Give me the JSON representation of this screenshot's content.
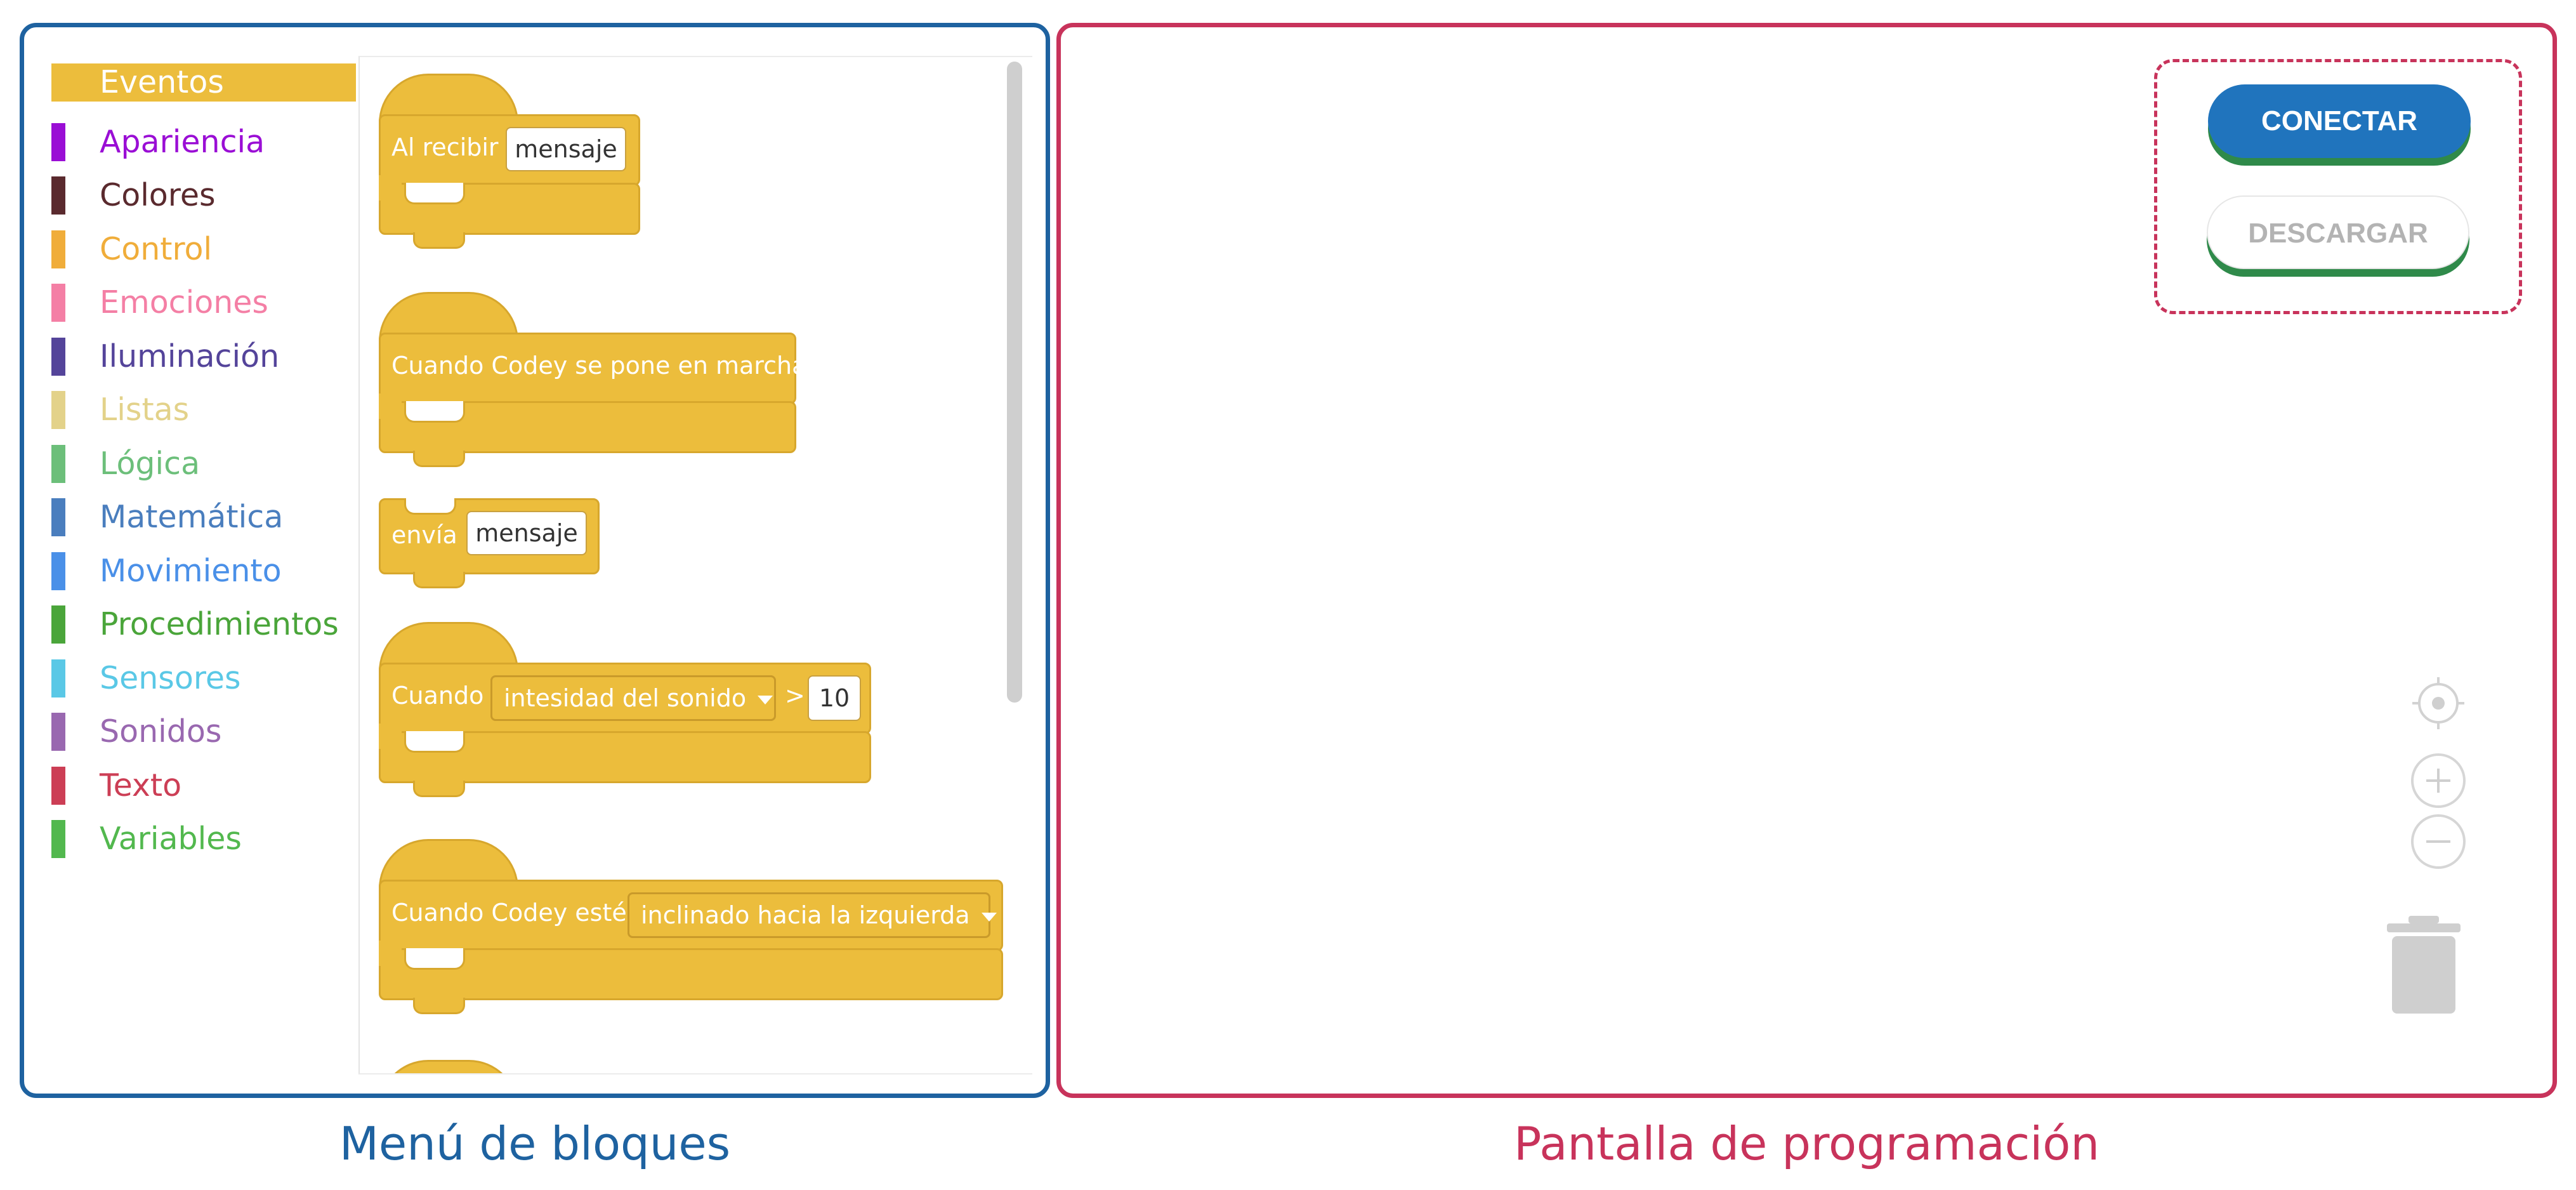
{
  "captions": {
    "menu": "Menú de bloques",
    "workspace": "Pantalla de programación"
  },
  "categories": [
    {
      "label": "Eventos",
      "color": "#ecbd3c",
      "selected": true
    },
    {
      "label": "Apariencia",
      "color": "#9a0ed5"
    },
    {
      "label": "Colores",
      "color": "#5a2a2e"
    },
    {
      "label": "Control",
      "color": "#f0ad3a"
    },
    {
      "label": "Emociones",
      "color": "#f47fa5"
    },
    {
      "label": "Iluminación",
      "color": "#54449a"
    },
    {
      "label": "Listas",
      "color": "#e3d28a"
    },
    {
      "label": "Lógica",
      "color": "#6cbf7a"
    },
    {
      "label": "Matemática",
      "color": "#4a7ebe"
    },
    {
      "label": "Movimiento",
      "color": "#4a90e8"
    },
    {
      "label": "Procedimientos",
      "color": "#4aa53a"
    },
    {
      "label": "Sensores",
      "color": "#5ac8e6"
    },
    {
      "label": "Sonidos",
      "color": "#9968b0"
    },
    {
      "label": "Texto",
      "color": "#cc3e55"
    },
    {
      "label": "Variables",
      "color": "#52b84e"
    }
  ],
  "blocks": {
    "receive": {
      "text": "Al recibir",
      "field": "mensaje"
    },
    "start": {
      "text": "Cuando Codey se pone en marcha"
    },
    "send": {
      "text": "envía",
      "field": "mensaje"
    },
    "sound": {
      "text": "Cuando",
      "dropdown": "intesidad del sonido",
      "op": ">",
      "value": "10"
    },
    "tilt": {
      "text": "Cuando Codey esté",
      "dropdown": "inclinado hacia la izquierda"
    }
  },
  "workspace": {
    "connect_label": "CONECTAR",
    "download_label": "DESCARGAR",
    "icons": [
      "center-icon",
      "zoom-in-icon",
      "zoom-out-icon",
      "trash-icon"
    ]
  }
}
